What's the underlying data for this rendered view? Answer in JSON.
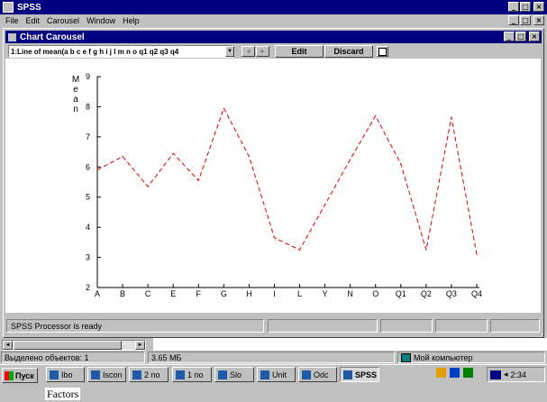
{
  "app": {
    "title": "SPSS"
  },
  "menu": [
    "File",
    "Edit",
    "Carousel",
    "Window",
    "Help"
  ],
  "chart_window": {
    "title": "Chart Carousel",
    "chart_select": "1:Line of mean(a b c e f g h i j l m n o q1 q2 q3 q4",
    "edit_label": "Edit",
    "discard_label": "Discard"
  },
  "chart_data": {
    "type": "line",
    "categories": [
      "A",
      "B",
      "C",
      "E",
      "F",
      "G",
      "H",
      "I",
      "L",
      "Y",
      "N",
      "O",
      "Q1",
      "Q2",
      "Q3",
      "Q4"
    ],
    "values": [
      5.9,
      6.35,
      5.35,
      6.45,
      5.55,
      7.95,
      6.35,
      3.65,
      3.25,
      4.75,
      6.25,
      7.7,
      6.1,
      3.25,
      7.65,
      3.1
    ],
    "ylabel": "Mean",
    "ylim": [
      2,
      9
    ],
    "yticks": [
      "2",
      "3",
      "4",
      "5",
      "6",
      "7",
      "8",
      "9"
    ],
    "line_color": "#e00000",
    "line_style": "dashed",
    "grid": false
  },
  "status": {
    "processor": "SPSS Processor is ready",
    "objects": "Выделено объектов: 1",
    "size": "3.65 МБ",
    "computer": "Мой компьютер"
  },
  "bg_fragment": "Factors",
  "taskbar": {
    "start": "Пуск",
    "buttons": [
      "Ibo",
      "Iscon",
      "2 no",
      "1 no",
      "Slo",
      "Unit",
      "Odc",
      "SPSS"
    ],
    "clock": "2:34"
  }
}
